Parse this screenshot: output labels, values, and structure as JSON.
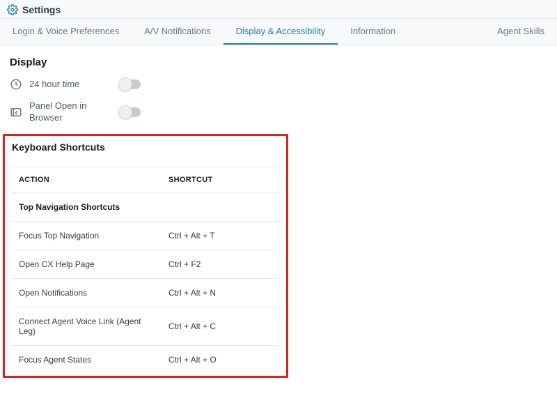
{
  "header": {
    "title": "Settings"
  },
  "tabs": [
    {
      "label": "Login & Voice Preferences",
      "active": false
    },
    {
      "label": "A/V Notifications",
      "active": false
    },
    {
      "label": "Display & Accessibility",
      "active": true
    },
    {
      "label": "Information",
      "active": false
    },
    {
      "label": "Agent Skills",
      "active": false
    }
  ],
  "display": {
    "section_title": "Display",
    "time24_label": "24 hour time",
    "panel_open_label": "Panel Open in Browser"
  },
  "keyboard": {
    "section_title": "Keyboard Shortcuts",
    "columns": {
      "action": "ACTION",
      "shortcut": "SHORTCUT"
    },
    "group_label": "Top Navigation Shortcuts",
    "rows": [
      {
        "action": "Focus Top Navigation",
        "shortcut": "Ctrl + Alt + T"
      },
      {
        "action": "Open CX Help Page",
        "shortcut": "Ctrl + F2"
      },
      {
        "action": "Open Notifications",
        "shortcut": "Ctrl + Alt + N"
      },
      {
        "action": "Connect Agent Voice Link (Agent Leg)",
        "shortcut": "Ctrl + Alt + C"
      },
      {
        "action": "Focus Agent States",
        "shortcut": "Ctrl + Alt + O"
      }
    ]
  }
}
